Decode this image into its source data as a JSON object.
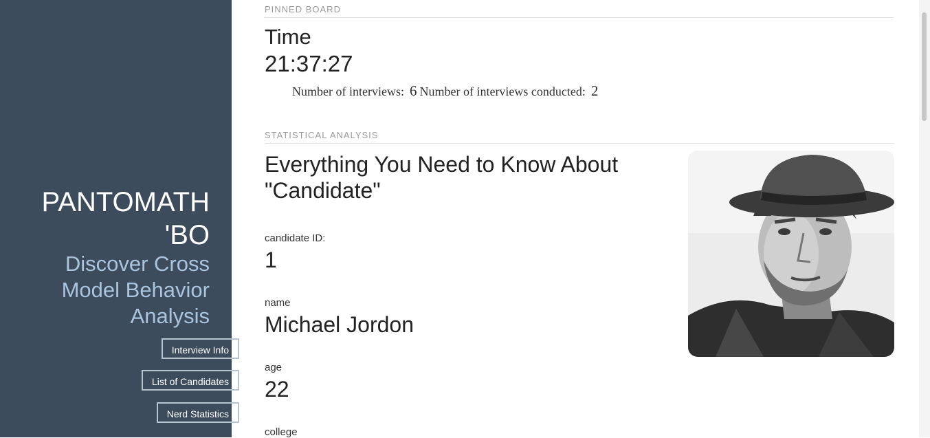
{
  "sidebar": {
    "brand": "PANTOMATH 'BO",
    "tagline": "Discover Cross Model Behavior Analysis",
    "nav": [
      {
        "label": "Interview Info"
      },
      {
        "label": "List of Candidates"
      },
      {
        "label": "Nerd Statistics"
      }
    ]
  },
  "pinned": {
    "section_label": "PINNED BOARD",
    "time_label": "Time",
    "time_value": "21:37:27",
    "interviews_label": "Number of interviews:",
    "interviews_value": "6",
    "conducted_label": "Number of interviews conducted:",
    "conducted_value": "2"
  },
  "analysis": {
    "section_label": "STATISTICAL ANALYSIS",
    "headline": "Everything You Need to Know About \"Candidate\"",
    "fields": [
      {
        "label": "candidate ID:",
        "value": "1"
      },
      {
        "label": "name",
        "value": "Michael Jordon"
      },
      {
        "label": "age",
        "value": "22"
      },
      {
        "label": "college",
        "value": ""
      }
    ],
    "photo_icon": "candidate-photo"
  },
  "colors": {
    "sidebar_bg": "#3c4c5c",
    "tagline": "#a9c4dc"
  }
}
